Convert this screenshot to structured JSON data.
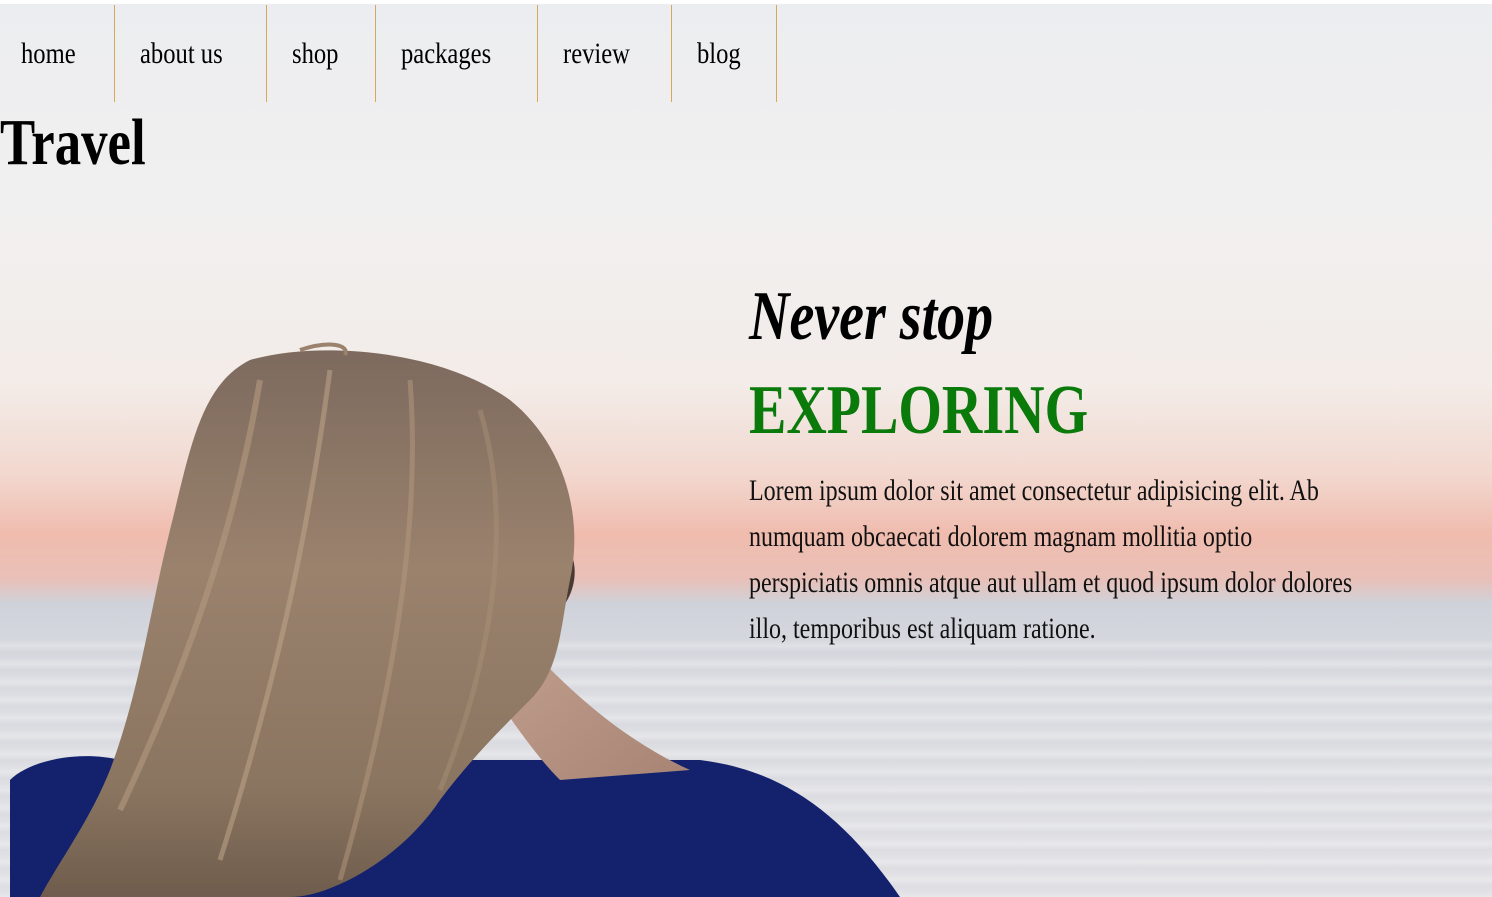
{
  "nav": {
    "items": [
      {
        "label": "home"
      },
      {
        "label": "about us"
      },
      {
        "label": "shop"
      },
      {
        "label": "packages"
      },
      {
        "label": "review"
      },
      {
        "label": "blog"
      }
    ]
  },
  "brand": {
    "title": "Travel"
  },
  "hero": {
    "line1": "Never stop",
    "line2": "EXPLORING",
    "body": "Lorem ipsum dolor sit amet consectetur adipisicing elit. Ab numquam obcaecati dolorem magnam mollitia optio perspiciatis omnis atque aut ullam et quod ipsum dolor dolores illo, temporibus est aliquam ratione."
  },
  "colors": {
    "nav_divider": "#d7a85a",
    "accent_green": "#0a7a0a",
    "text": "#000000"
  },
  "background": {
    "image_alt_icon": "woman-looking-at-sea-image"
  }
}
